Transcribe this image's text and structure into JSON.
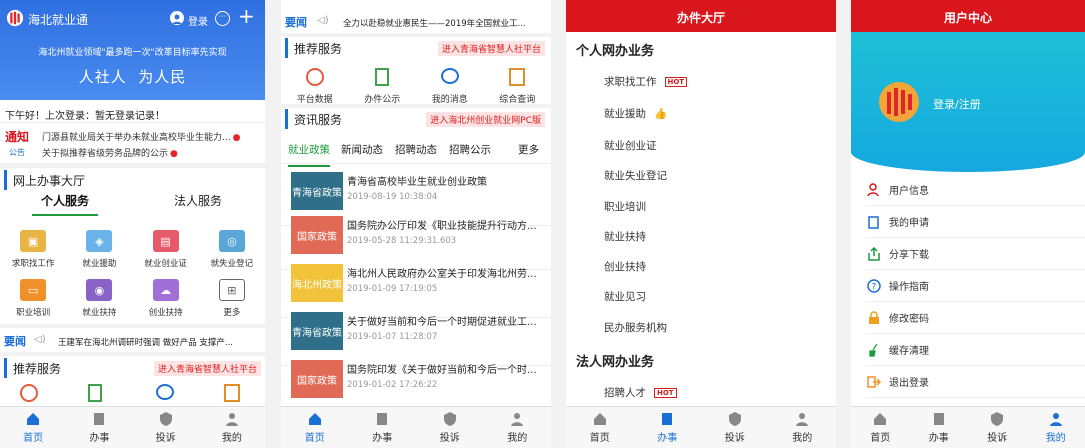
{
  "p1": {
    "app_name": "海北就业通",
    "login_label": "登录",
    "slogan_small": "海北州就业领域\"最多跑一次\"改革目标率先实现",
    "slogan_big": "人社人  为人民",
    "greeting": "下午好！上次登录：暂无登录记录！",
    "notice_tag1": "通知",
    "notice_tag2": "公告",
    "notice1": "门源县就业局关于举办未就业高校毕业生能力...",
    "notice2": "关于拟推荐省级劳务品牌的公示",
    "hall_title": "网上办事大厅",
    "tab_personal": "个人服务",
    "tab_corp": "法人服务",
    "services": [
      "求职找工作",
      "就业援助",
      "就业创业证",
      "就失业登记",
      "职业培训",
      "就业扶持",
      "创业扶持",
      "更多"
    ],
    "headline_tag": "要闻",
    "headline": "王建军在海北州调研时强调 做好产品 支撑产...",
    "recommend_title": "推荐服务",
    "recommend_link": "进入青海省智慧人社平台"
  },
  "p2": {
    "headline_tag": "要闻",
    "headline": "全力以赴稳就业惠民生——2019年全国就业工...",
    "recommend_title": "推荐服务",
    "recommend_link": "进入青海省智慧人社平台",
    "rec_items": [
      "平台数据",
      "办件公示",
      "我的消息",
      "综合查询"
    ],
    "info_title": "资讯服务",
    "info_link": "进入海北州创业就业网PC版",
    "news_tabs": [
      "就业政策",
      "新闻动态",
      "招聘动态",
      "招聘公示",
      "更多"
    ],
    "news": [
      {
        "tag": "青海省政策",
        "title": "青海省高校毕业生就业创业政策",
        "date": "2019-08-19 10:38:04"
      },
      {
        "tag": "国家政策",
        "title": "国务院办公厅印发《职业技能提升行动方...",
        "date": "2019-05-28 11:29:31.603"
      },
      {
        "tag": "海北州政策",
        "title": "海北州人民政府办公室关于印发海北州劳...",
        "date": "2019-01-09 17:19:05"
      },
      {
        "tag": "青海省政策",
        "title": "关于做好当前和今后一个时期促进就业工...",
        "date": "2019-01-07 11:28:07"
      },
      {
        "tag": "国家政策",
        "title": "国务院印发《关于做好当前和今后一个时...",
        "date": "2019-01-02 17:26:22"
      }
    ]
  },
  "p3": {
    "title": "办件大厅",
    "personal_header": "个人网办业务",
    "personal_items": [
      "求职找工作",
      "就业援助",
      "就业创业证",
      "就业失业登记",
      "职业培训",
      "就业扶持",
      "创业扶持",
      "就业见习",
      "民办服务机构"
    ],
    "hot_label": "HOT",
    "corp_header": "法人网办业务",
    "corp_items": [
      "招聘人才"
    ]
  },
  "p4": {
    "title": "用户中心",
    "login_register": "登录/注册",
    "items": [
      "用户信息",
      "我的申请",
      "分享下载",
      "操作指南",
      "修改密码",
      "缓存清理",
      "退出登录"
    ]
  },
  "tabbar": [
    "首页",
    "办事",
    "投诉",
    "我的"
  ],
  "colors": {
    "blue": "#1a6fd6",
    "red": "#d9161c",
    "hero_blue": "#2f7fe8",
    "tab_active": "#1a6fd6"
  }
}
